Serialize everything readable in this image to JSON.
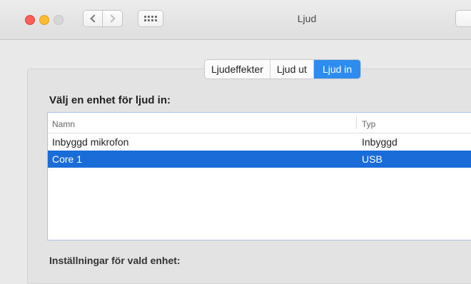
{
  "window": {
    "title": "Ljud"
  },
  "tabs": [
    {
      "label": "Ljudeffekter"
    },
    {
      "label": "Ljud ut"
    },
    {
      "label": "Ljud in"
    }
  ],
  "device_section": {
    "label": "Välj en enhet för ljud in:",
    "columns": {
      "name": "Namn",
      "type": "Typ"
    },
    "rows": [
      {
        "name": "Inbyggd mikrofon",
        "type": "Inbyggd"
      },
      {
        "name": "Core 1",
        "type": "USB"
      }
    ],
    "selected_row": 1
  },
  "settings_label": "Inställningar för vald enhet:",
  "colors": {
    "accent": "#2e8cf0",
    "selection": "#1a6dd8",
    "close": "#fc5f57",
    "minimize": "#fdbc2f"
  }
}
